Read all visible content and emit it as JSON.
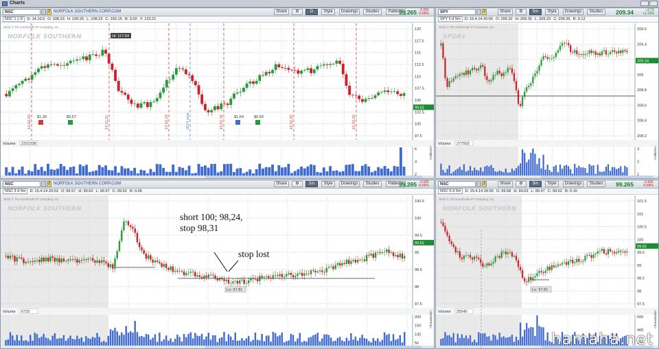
{
  "window": {
    "title": "Charts"
  },
  "panels": {
    "tl": {
      "symbol": "NSC",
      "link": "2",
      "company": "NORFOLK SOUTHERN CORP.COM",
      "buttons": {
        "share": "Share",
        "tf": "D",
        "style": "Style",
        "drawings": "Drawings",
        "studies": "Studies",
        "patterns": "Patterns"
      },
      "price": "99.265",
      "chg_pct": "-0.695",
      "chg_abs": "-0.69%",
      "ohlc": {
        "tag": "NSC 1 y D",
        "d": "D: 14.10.0",
        "o": "O: 108.23",
        "h": "H: 109.25",
        "l": "L: 108.23",
        "c": "C: 109.15",
        "r": "R: 3.02",
        "y": "Y: 123.21"
      },
      "copyright": "2015 © TD Ameritrade IP Company, Inc",
      "logo": "NORFOLK SOUTHERN",
      "hi_label": "Hi: 117.64",
      "y_ticks": [
        "120",
        "117.5",
        "115",
        "112.5",
        "110",
        "107.5",
        "105",
        "102.5",
        "100",
        "97.5"
      ],
      "last_tag": "99.62",
      "date_labels": [
        "14.10.15",
        "14.11.21",
        "14.12.19",
        "2014 year",
        "15.01.16",
        "15.02.20",
        "15.03.20"
      ],
      "events": [
        {
          "v": "$1.39"
        },
        {
          "v": "$0.57"
        },
        {
          "v": "$1.64"
        },
        {
          "v": "$0.59"
        }
      ],
      "volume_label": "Volume",
      "volume_value": "2322338",
      "vol_ticks": [
        "6",
        "4",
        "2"
      ],
      "vol_unit": "<millions>",
      "x_ticks": [
        "10.20",
        "11.3",
        "11.10",
        "11.17",
        "12.1",
        "12.8",
        "12.15",
        "13.22",
        "12.29",
        "1.12",
        "1.19",
        "2.2",
        "2.9",
        "2.16",
        "3.2",
        "3.9",
        "3.16",
        "3.23",
        "4.6",
        "4.13"
      ],
      "x_marker": "10.6"
    },
    "tr": {
      "symbol": "SPY",
      "link": "2",
      "company": "",
      "buttons": {
        "share": "Share",
        "tf": "5m",
        "style": "Style",
        "drawings": "Drawings",
        "studies": "Studies"
      },
      "price": "209.34",
      "chg_pct": "+2.75",
      "chg_abs": "+1.33%",
      "ohlc": {
        "tag": "SPY 5 d 5m",
        "d": "D: 15.4.14 20:55",
        "o": "O: 209.32",
        "h": "H: 209.35",
        "l": "L: 209.23",
        "c": "C: 209.35",
        "r": "R: 0.12"
      },
      "copyright": "2015 © TD Ameritrade IP Company, Inc",
      "logo": "SPDRs",
      "y_ticks": [
        "209.6",
        "209.4",
        "209.2",
        "209",
        "208.8",
        "208.6",
        "208.4",
        "208.2"
      ],
      "last_tag": "209.34",
      "volume_label": "Volume",
      "volume_value": "277503",
      "vol_ticks": [
        "3",
        "2",
        "1"
      ],
      "vol_unit": "<millions>",
      "x_ticks": [
        "11",
        "12",
        "13",
        "14",
        "15",
        "16",
        "17",
        "18",
        "19",
        "20",
        "21",
        "22",
        "23"
      ]
    },
    "bl": {
      "symbol": "NSC",
      "link": "2",
      "company": "NORFOLK SOUTHERN CORP.COM",
      "buttons": {
        "share": "Share",
        "tf": "1m",
        "style": "Style",
        "drawings": "Drawings",
        "studies": "Studies",
        "patterns": "Patterns"
      },
      "price": "99.265",
      "chg_pct": "-0.695",
      "chg_abs": "-0.69%",
      "ohlc": {
        "tag": "NSC 3 d 5m",
        "d": "D: 15.4.14 20:53",
        "o": "O: 99.57",
        "h": "H: 99.63",
        "l": "L: 99.57",
        "c": "C: 99.62",
        "r": "R: 0.06"
      },
      "copyright": "2015 © TD Ameritrade IP Company, Inc",
      "logo": "NORFOLK SOUTHERN",
      "lo_label": "Lo: 97.81",
      "y_ticks": [
        "100.5",
        "100",
        "99.5",
        "99",
        "98.5",
        "98",
        "97.5"
      ],
      "last_tag": "99.62",
      "volume_label": "Volume",
      "volume_value": "6732",
      "vol_ticks": [
        "200",
        "150",
        "100",
        "50"
      ],
      "vol_unit": "<thousands>",
      "x_ticks": [
        "15:50",
        "16:00",
        "16:15",
        "16:30",
        "16:45",
        "17:00",
        "17:15",
        "17:30",
        "17:45",
        "18:00",
        "18:15"
      ]
    },
    "br": {
      "symbol": "NSC",
      "link": "2",
      "company": "",
      "buttons": {
        "share": "Share",
        "tf": "5m",
        "style": "Style",
        "drawings": "Drawings",
        "studies": "Studies"
      },
      "price": "99.265",
      "chg_pct": "-0.695",
      "chg_abs": "-0.69%",
      "ohlc": {
        "tag": "NSC 5 d 5m",
        "d": "D: 15.4.14 20:50",
        "o": "O: 99.58",
        "h": "H: 99.63",
        "l": "L: 99.47",
        "c": "C: 99.62",
        "r": "R: 0.16"
      },
      "copyright": "2015 © TD Ameritrade IP Company, Inc",
      "logo": "NORFOLK SOUTHERN",
      "lo_label": "Lo: 97.81",
      "y_ticks": [
        "101.5",
        "101",
        "100.5",
        "100",
        "99.5",
        "99",
        "98.5",
        "98",
        "97.5"
      ],
      "last_tag": "99.62",
      "volume_label": "Volume",
      "volume_value": "25549",
      "vol_ticks": [
        "600",
        "400",
        "200"
      ],
      "vol_unit": "<thousands>",
      "x_ticks": [
        "Apr",
        "13",
        "14",
        "15",
        "16",
        "17",
        "18"
      ]
    }
  },
  "annotations": {
    "trade_line1": "short 100; 98,24,",
    "trade_line2": "stop 98,31",
    "stop_lost": "stop lost"
  },
  "watermark": "hamaha.net",
  "colors": {
    "up": "#2a9a3b",
    "down": "#c8242b",
    "price_green": "#0e7a24",
    "volume": "#3f6bd0",
    "date_line": "#d83a3a",
    "year_line": "#4b7fd8",
    "session_shade": "#e9e9e9"
  }
}
